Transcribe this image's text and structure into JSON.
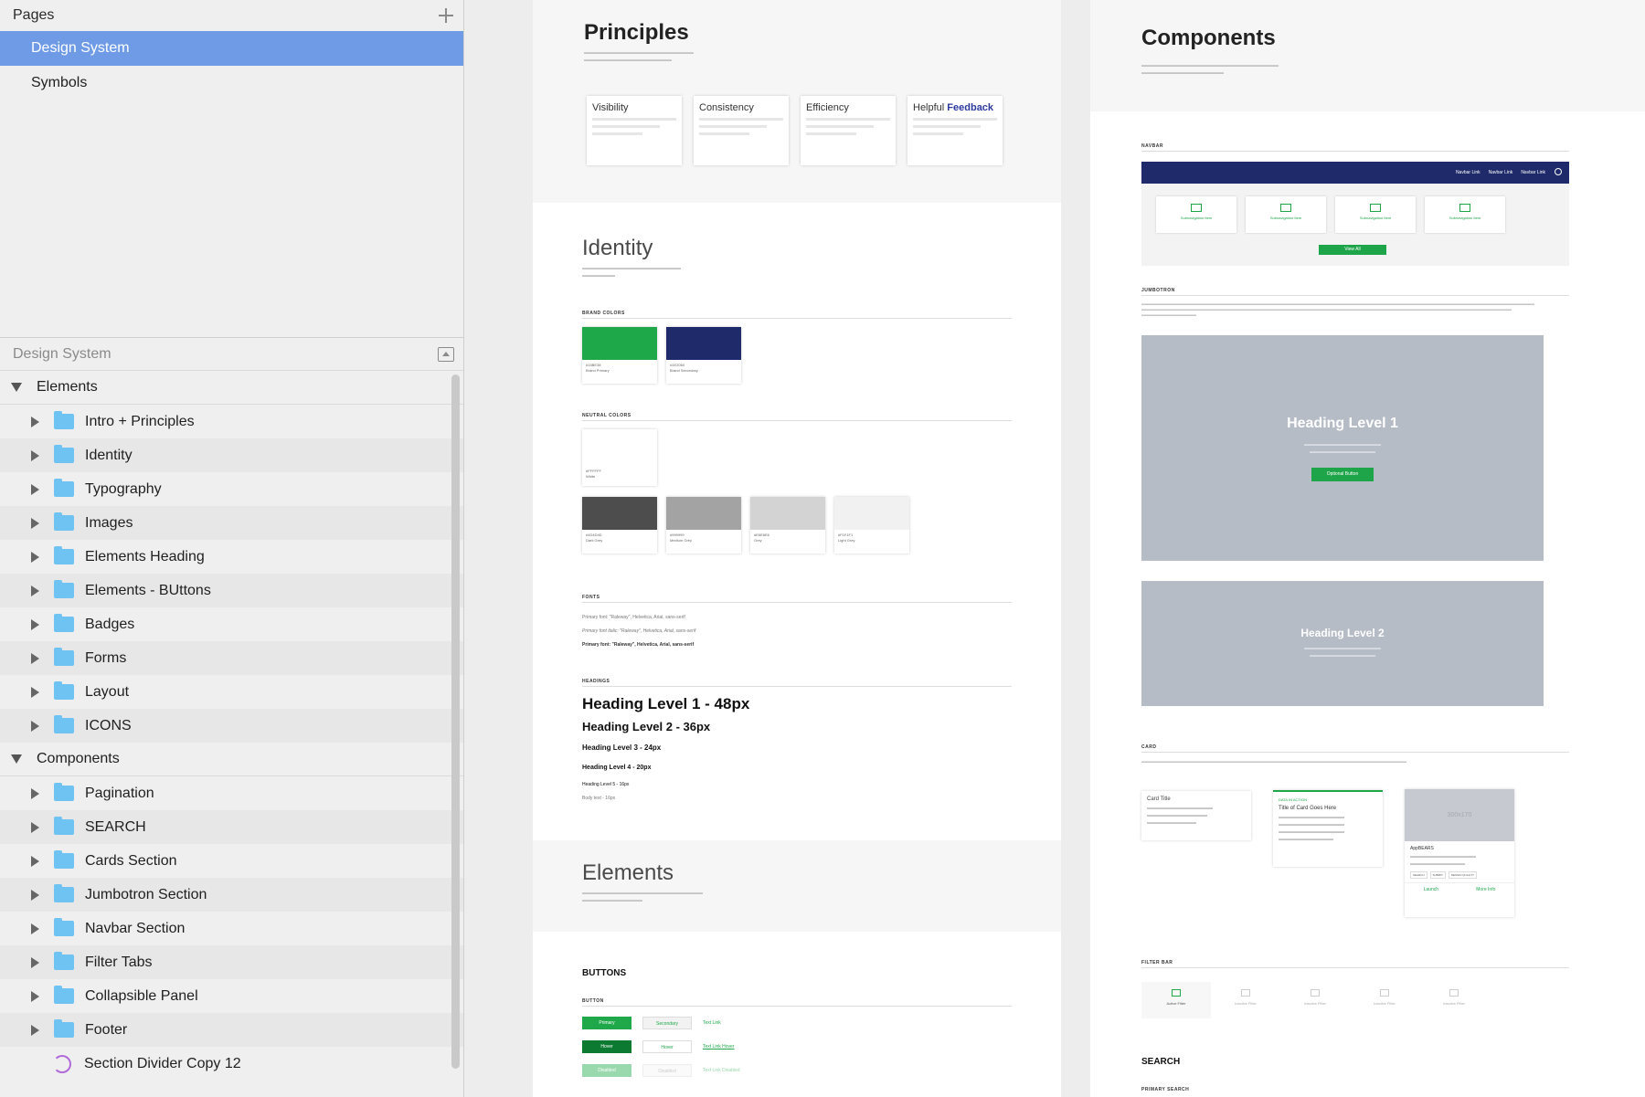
{
  "sidebar": {
    "pages_title": "Pages",
    "pages": [
      {
        "label": "Design System",
        "selected": true
      },
      {
        "label": "Symbols",
        "selected": false
      }
    ],
    "layers_title": "Design System",
    "groups": [
      {
        "label": "Elements",
        "items": [
          "Intro + Principles",
          "Identity",
          "Typography",
          "Images",
          "Elements Heading",
          "Elements - BUttons",
          "Badges",
          "Forms",
          "Layout",
          "ICONS"
        ]
      },
      {
        "label": "Components",
        "items": [
          "Pagination",
          "SEARCH",
          "Cards Section",
          "Jumbotron Section",
          "Navbar Section",
          "Filter Tabs",
          "Collapsible Panel",
          "Footer"
        ]
      }
    ],
    "symbol_item": "Section Divider Copy 12"
  },
  "artboard1": {
    "principles_title": "Principles",
    "principles": [
      {
        "title": "Visibility"
      },
      {
        "title": "Consistency"
      },
      {
        "title": "Efficiency"
      },
      {
        "title_a": "Helpful ",
        "title_b": "Feedback"
      }
    ],
    "identity_title": "Identity",
    "brand_colors_label": "BRAND COLORS",
    "brand_colors": [
      {
        "hex": "#1EA84A",
        "code": "#15BE38",
        "name": "Brand Primary"
      },
      {
        "hex": "#1F2A6A",
        "code": "#1E2060",
        "name": "Brand Secondary"
      }
    ],
    "neutral_colors_label": "NEUTRAL COLORS",
    "white_swatch": {
      "hex": "#FFFFFF",
      "code": "#FFFFFF",
      "name": "White"
    },
    "neutral_colors": [
      {
        "hex": "#4D4D4D",
        "code": "#4D4D4D",
        "name": "Dark Grey"
      },
      {
        "hex": "#A3A3A3",
        "code": "#999999",
        "name": "Medium Grey"
      },
      {
        "hex": "#D3D3D3",
        "code": "#E6E6E6",
        "name": "Grey"
      },
      {
        "hex": "#F1F1F1",
        "code": "#F1F1F1",
        "name": "Light Grey"
      }
    ],
    "fonts_label": "FONTS",
    "font_lines": [
      "Primary font: \"Raleway\", Helvetica, Arial, sans-serif",
      "Primary font italic: \"Raleway\", Helvetica, Arial, sans-serif",
      "Primary font: \"Raleway\", Helvetica, Arial, sans-serif"
    ],
    "headings_label": "HEADINGS",
    "headings": [
      "Heading Level 1 - 48px",
      "Heading Level 2 - 36px",
      "Heading Level 3 - 24px",
      "Heading Level 4 - 20px",
      "Heading Level 5 - 16px",
      "Body text - 16px"
    ],
    "elements_title": "Elements",
    "buttons_title": "BUTTONS",
    "button_label": "BUTTON",
    "buttons": {
      "primary": "Primary",
      "secondary": "Secondary",
      "textlink": "Text Link",
      "hover": "Hover",
      "hover2": "Hover",
      "textlink_hover": "Text Link Hover",
      "disabled": "Disabled",
      "disabled2": "Disabled",
      "textlink_disabled": "Text Link Disabled"
    }
  },
  "artboard2": {
    "components_title": "Components",
    "navbar_label": "NAVBAR",
    "nav_links": [
      "Navbar Link",
      "Navbar Link",
      "Navbar Link"
    ],
    "subnav_items": [
      "Subnavigation Item",
      "Subnavigation Item",
      "Subnavigation Item",
      "Subnavigation Item"
    ],
    "view_all": "View All",
    "jumbotron_label": "JUMBOTRON",
    "jumbo1_title": "Heading Level 1",
    "jumbo1_button": "Optional Button",
    "jumbo2_title": "Heading Level 2",
    "card_label": "CARD",
    "card1_title": "Card Title",
    "card2_tag": "DATA IN ACTION",
    "card2_title": "Title of Card Goes Here",
    "card3_image": "300x170",
    "card3_title": "AppBEARS",
    "card3_tags": [
      "SEARCH",
      "SUBMIT",
      "DESIGN QUALITY"
    ],
    "card3_launch": "Launch",
    "card3_more": "More Info",
    "filter_label": "FILTER BAR",
    "filter_tabs": [
      "Active Filter",
      "Inactive Filter",
      "Inactive Filter",
      "Inactive Filter",
      "Inactive Filter"
    ],
    "search_title": "SEARCH",
    "primary_search_label": "PRIMARY SEARCH"
  }
}
